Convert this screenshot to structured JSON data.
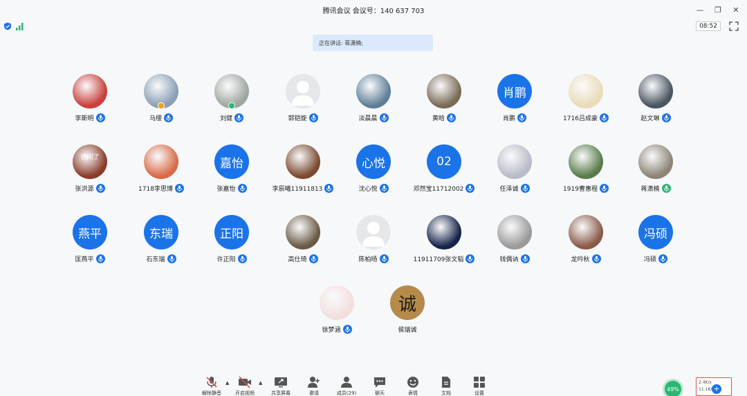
{
  "window": {
    "title": "腾讯会议 会议号：140 637 703",
    "minimize_glyph": "—",
    "restore_glyph": "❐",
    "close_glyph": "✕"
  },
  "status": {
    "timer": "08:52",
    "speaking": "正在讲话: 蒋潇楠;"
  },
  "participants": [
    {
      "name": "李斯明",
      "avatar": "photo",
      "color": "#c9403c",
      "mic": "blue"
    },
    {
      "name": "马缨",
      "avatar": "photo",
      "color": "#8a9fb5",
      "mic": "blue",
      "badge": "#f0a020"
    },
    {
      "name": "刘健",
      "avatar": "photo",
      "color": "#9ea7a0",
      "mic": "blue",
      "badge": "#2bb673"
    },
    {
      "name": "郭铠旋",
      "avatar": "default",
      "mic": "blue"
    },
    {
      "name": "淡晨晨",
      "avatar": "photo",
      "color": "#5f7f98",
      "mic": "blue"
    },
    {
      "name": "黄晗",
      "avatar": "photo",
      "color": "#7a6a55",
      "mic": "blue"
    },
    {
      "name": "肖鹏",
      "avatar": "text",
      "text": "肖鹏",
      "mic": "blue"
    },
    {
      "name": "1716吕成豪",
      "avatar": "photo",
      "color": "#e9dcb8",
      "mic": "blue"
    },
    {
      "name": "赵文琳",
      "avatar": "photo",
      "color": "#4a5560",
      "mic": "blue"
    },
    {
      "name": "张洪源",
      "avatar": "photo",
      "color": "#8a3b2a",
      "mic": "blue",
      "text": "自闭了"
    },
    {
      "name": "1718李思博",
      "avatar": "photo",
      "color": "#d96a48",
      "mic": "blue"
    },
    {
      "name": "张嘉怡",
      "avatar": "text",
      "text": "嘉怡",
      "mic": "blue"
    },
    {
      "name": "李辰曦11911813",
      "avatar": "photo",
      "color": "#7b4a30",
      "mic": "blue"
    },
    {
      "name": "沈心悦",
      "avatar": "text",
      "text": "心悦",
      "mic": "blue"
    },
    {
      "name": "邓然宝11712002",
      "avatar": "text",
      "text": "02",
      "mic": "blue"
    },
    {
      "name": "任泽诚",
      "avatar": "photo",
      "color": "#b8bcc8",
      "mic": "blue"
    },
    {
      "name": "1919曹惠程",
      "avatar": "photo",
      "color": "#5a7c4a",
      "mic": "blue"
    },
    {
      "name": "蒋潇楠",
      "avatar": "photo",
      "color": "#8c8476",
      "mic": "green"
    },
    {
      "name": "匡燕平",
      "avatar": "text",
      "text": "燕平",
      "mic": "blue"
    },
    {
      "name": "石东瑞",
      "avatar": "text",
      "text": "东瑞",
      "mic": "blue"
    },
    {
      "name": "许正阳",
      "avatar": "text",
      "text": "正阳",
      "mic": "blue"
    },
    {
      "name": "高仕琦",
      "avatar": "photo",
      "color": "#6a5a45",
      "mic": "blue"
    },
    {
      "name": "陈柏旸",
      "avatar": "default",
      "mic": "blue"
    },
    {
      "name": "11911709张文韬",
      "avatar": "photo",
      "color": "#15234a",
      "mic": "blue"
    },
    {
      "name": "钱偶讷",
      "avatar": "photo",
      "color": "#9a9a9a",
      "mic": "blue"
    },
    {
      "name": "龙吟秋",
      "avatar": "photo",
      "color": "#8a5a4a",
      "mic": "blue"
    },
    {
      "name": "冯硕",
      "avatar": "text",
      "text": "冯硕",
      "mic": "blue"
    },
    {
      "name": "徐梦涵",
      "avatar": "photo",
      "color": "#f3dede",
      "mic": "blue"
    },
    {
      "name": "侯瑞诚",
      "avatar": "text-dark",
      "text": "诚",
      "color": "#b58a4a",
      "mic": "none"
    }
  ],
  "toolbar": {
    "unmute": "解除静音",
    "video": "开启视频",
    "share": "共享屏幕",
    "invite": "邀请",
    "members": "成员(29)",
    "chat": "聊天",
    "emoji": "表情",
    "docs": "文档",
    "settings": "设置"
  },
  "network": {
    "percent": "49%",
    "up": "2.4K/s",
    "down": "11.1K/s"
  }
}
